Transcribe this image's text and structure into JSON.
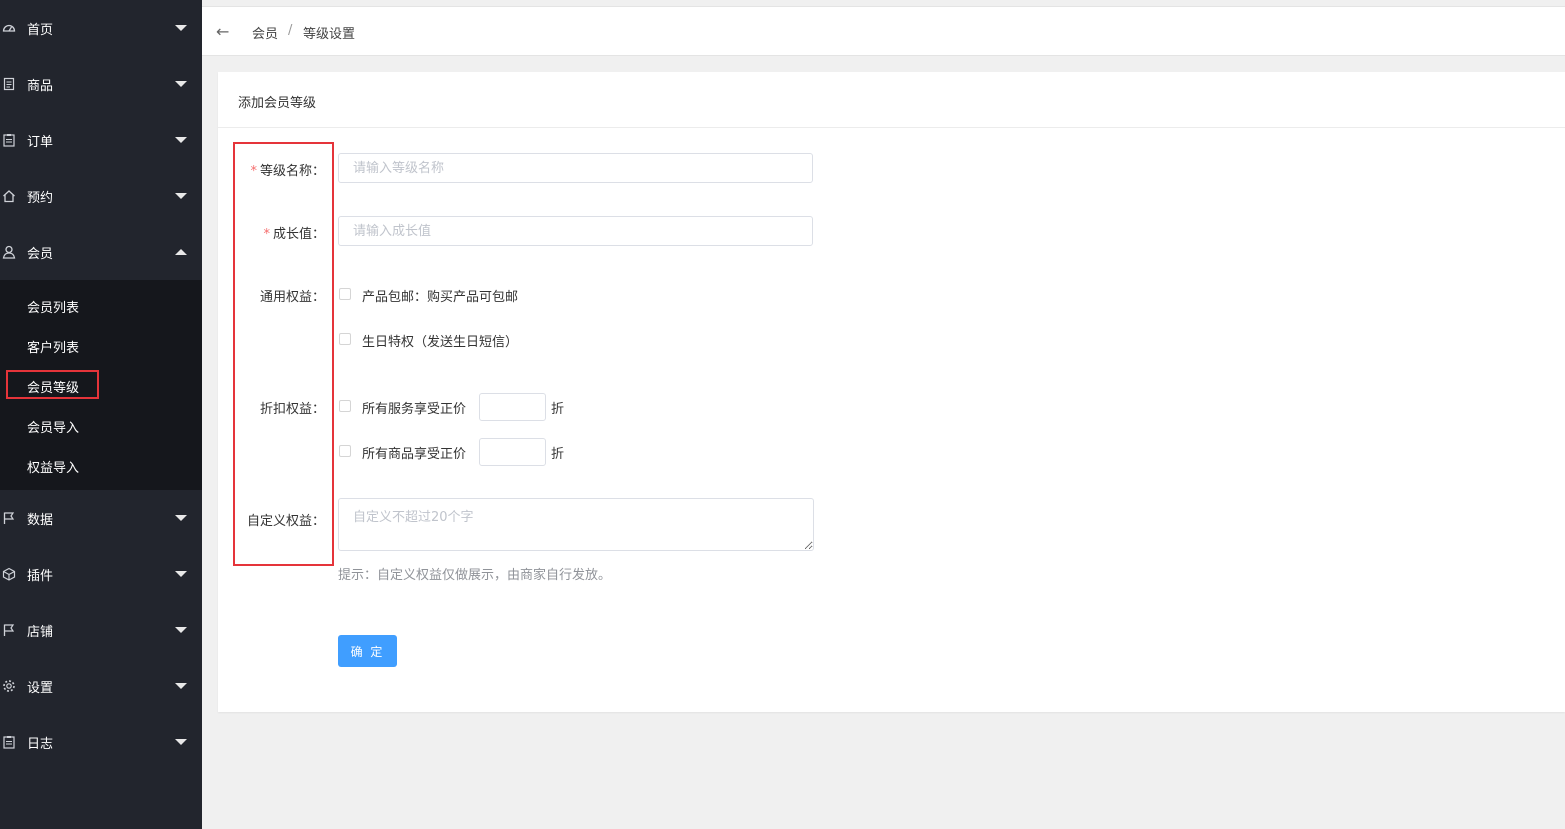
{
  "sidebar": {
    "menu_top": [
      {
        "label": "首页",
        "icon": "dashboard-icon"
      },
      {
        "label": "商品",
        "icon": "document-icon"
      },
      {
        "label": "订单",
        "icon": "clipboard-icon"
      },
      {
        "label": "预约",
        "icon": "home-icon"
      },
      {
        "label": "会员",
        "icon": "user-icon"
      }
    ],
    "member_sub": [
      {
        "label": "会员列表"
      },
      {
        "label": "客户列表"
      },
      {
        "label": "会员等级"
      },
      {
        "label": "会员导入"
      },
      {
        "label": "权益导入"
      }
    ],
    "menu_bottom": [
      {
        "label": "数据",
        "icon": "flag-icon"
      },
      {
        "label": "插件",
        "icon": "cube-icon"
      },
      {
        "label": "店铺",
        "icon": "flag-icon"
      },
      {
        "label": "设置",
        "icon": "gear-icon"
      },
      {
        "label": "日志",
        "icon": "clipboard-icon"
      }
    ]
  },
  "breadcrumb": {
    "back": "←",
    "parent": "会员",
    "separator": "/",
    "current": "等级设置"
  },
  "card": {
    "title": "添加会员等级"
  },
  "form": {
    "required_mark": "*",
    "level_name_label": "等级名称：",
    "level_name_placeholder": "请输入等级名称",
    "growth_label": "成长值：",
    "growth_placeholder": "请输入成长值",
    "common_rights_label": "通用权益：",
    "common_rights_options": [
      "产品包邮：购买产品可包邮",
      "生日特权（发送生日短信）"
    ],
    "discount_label": "折扣权益：",
    "discount_service": "所有服务享受正价",
    "discount_goods": "所有商品享受正价",
    "discount_unit": "折",
    "custom_label": "自定义权益：",
    "custom_placeholder": "自定义不超过20个字",
    "hint": "提示：自定义权益仅做展示，由商家自行发放。",
    "submit": "确 定"
  },
  "colors": {
    "sidebar_bg": "#22252d",
    "submenu_bg": "#15171c",
    "primary": "#409eff",
    "highlight": "#e5343a",
    "required": "#f56c6c"
  }
}
